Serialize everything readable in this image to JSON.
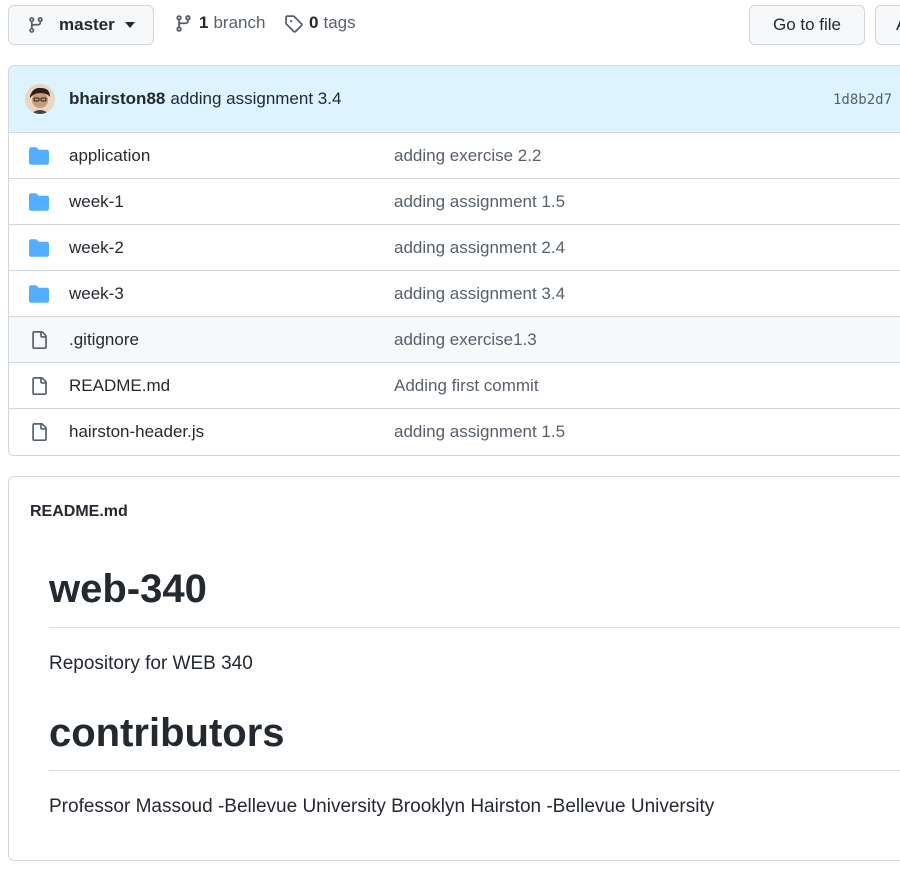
{
  "toolbar": {
    "branch_name": "master",
    "branch_count": "1",
    "branch_label": "branch",
    "tag_count": "0",
    "tag_label": "tags",
    "goto_file_label": "Go to file",
    "add_file_label": "A"
  },
  "commit": {
    "author": "bhairston88",
    "message": "adding assignment 3.4",
    "hash": "1d8b2d7"
  },
  "files": [
    {
      "type": "folder",
      "name": "application",
      "message": "adding exercise 2.2"
    },
    {
      "type": "folder",
      "name": "week-1",
      "message": "adding assignment 1.5"
    },
    {
      "type": "folder",
      "name": "week-2",
      "message": "adding assignment 2.4"
    },
    {
      "type": "folder",
      "name": "week-3",
      "message": "adding assignment 3.4"
    },
    {
      "type": "file",
      "name": ".gitignore",
      "message": "adding exercise1.3"
    },
    {
      "type": "file",
      "name": "README.md",
      "message": "Adding first commit"
    },
    {
      "type": "file",
      "name": "hairston-header.js",
      "message": "adding assignment 1.5"
    }
  ],
  "readme": {
    "filename": "README.md",
    "heading1": "web-340",
    "paragraph1": "Repository for WEB 340",
    "heading2": "contributors",
    "paragraph2": "Professor Massoud -Bellevue University Brooklyn Hairston -Bellevue University"
  },
  "colors": {
    "folder": "#54aeff",
    "file_icon": "#57606a",
    "commit_bar": "#ddf4ff",
    "border": "#d0d7de"
  },
  "icons": [
    "git-branch-icon",
    "tag-icon",
    "caret-down-icon",
    "folder-icon",
    "file-icon",
    "avatar"
  ]
}
